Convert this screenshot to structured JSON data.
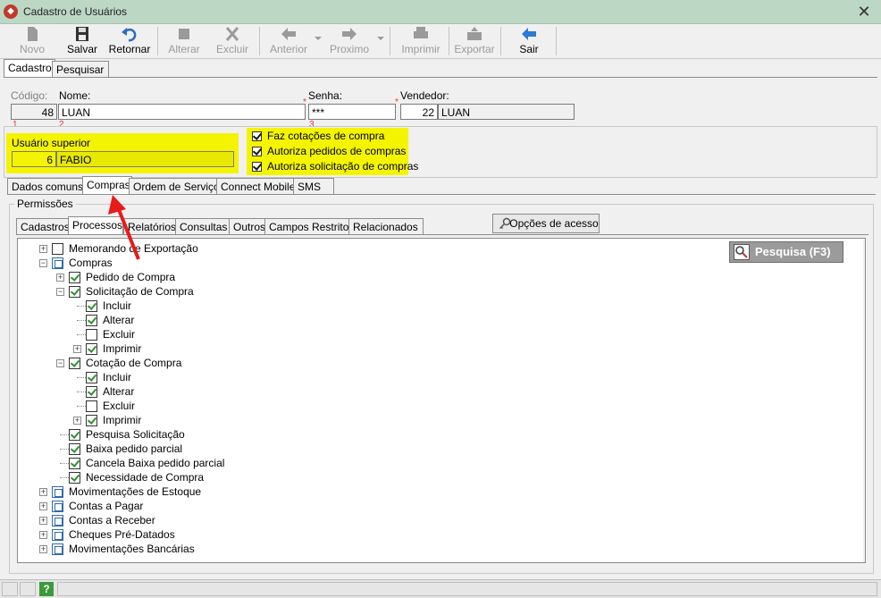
{
  "window": {
    "title": "Cadastro de Usuários",
    "close": "✕"
  },
  "toolbar": {
    "novo": "Novo",
    "salvar": "Salvar",
    "retornar": "Retornar",
    "alterar": "Alterar",
    "excluir": "Excluir",
    "anterior": "Anterior",
    "proximo": "Proximo",
    "imprimir": "Imprimir",
    "exportar": "Exportar",
    "sair": "Sair"
  },
  "main_tabs": {
    "cadastro": "Cadastro",
    "pesquisar": "Pesquisar"
  },
  "form": {
    "codigo_label": "Código:",
    "codigo_value": "48",
    "nome_label": "Nome:",
    "nome_value": "LUAN",
    "senha_label": "Senha:",
    "senha_value": "***",
    "vendedor_label": "Vendedor:",
    "vendedor_code": "22",
    "vendedor_name": "LUAN",
    "superior_label": "Usuário superior",
    "superior_code": "6",
    "superior_name": "FABIO",
    "req_1": "1",
    "req_2": "2",
    "req_3": "3"
  },
  "options": [
    {
      "label": "Faz cotações de compra",
      "checked": true
    },
    {
      "label": "Autoriza pedidos de compras",
      "checked": true
    },
    {
      "label": "Autoriza solicitação de compras",
      "checked": true
    }
  ],
  "section_tabs": {
    "dados": "Dados comuns",
    "compras": "Compras",
    "ordem": "Ordem de Serviço",
    "connect": "Connect Mobile",
    "sms": "SMS"
  },
  "permissoes": {
    "title": "Permissões",
    "tabs": {
      "cadastros": "Cadastros",
      "processos": "Processos",
      "relatorios": "Relatórios",
      "consultas": "Consultas",
      "outros": "Outros",
      "campos": "Campos Restritos",
      "relacionados": "Relacionados"
    },
    "opcoes_button": "Opções de acesso",
    "search_button": "Pesquisa (F3)"
  },
  "tree": [
    {
      "label": "Memorando de Exportação",
      "state": "unchecked"
    },
    {
      "label": "Compras",
      "state": "partial"
    },
    {
      "label": "Pedido de Compra",
      "state": "checked"
    },
    {
      "label": "Solicitação de Compra",
      "state": "checked"
    },
    {
      "label": "Incluir",
      "state": "checked"
    },
    {
      "label": "Alterar",
      "state": "checked"
    },
    {
      "label": "Excluir",
      "state": "unchecked"
    },
    {
      "label": "Imprimir",
      "state": "checked"
    },
    {
      "label": "Cotação de Compra",
      "state": "checked"
    },
    {
      "label": "Incluir",
      "state": "checked"
    },
    {
      "label": "Alterar",
      "state": "checked"
    },
    {
      "label": "Excluir",
      "state": "unchecked"
    },
    {
      "label": "Imprimir",
      "state": "checked"
    },
    {
      "label": "Pesquisa Solicitação",
      "state": "checked"
    },
    {
      "label": "Baixa pedido parcial",
      "state": "checked"
    },
    {
      "label": "Cancela Baixa pedido parcial",
      "state": "checked"
    },
    {
      "label": "Necessidade de Compra",
      "state": "checked"
    },
    {
      "label": "Movimentações de Estoque",
      "state": "partial"
    },
    {
      "label": "Contas a Pagar",
      "state": "partial"
    },
    {
      "label": "Contas a Receber",
      "state": "partial"
    },
    {
      "label": "Cheques Pré-Datados",
      "state": "partial"
    },
    {
      "label": "Movimentações Bancárias",
      "state": "partial"
    }
  ],
  "status": {
    "help": "?"
  }
}
